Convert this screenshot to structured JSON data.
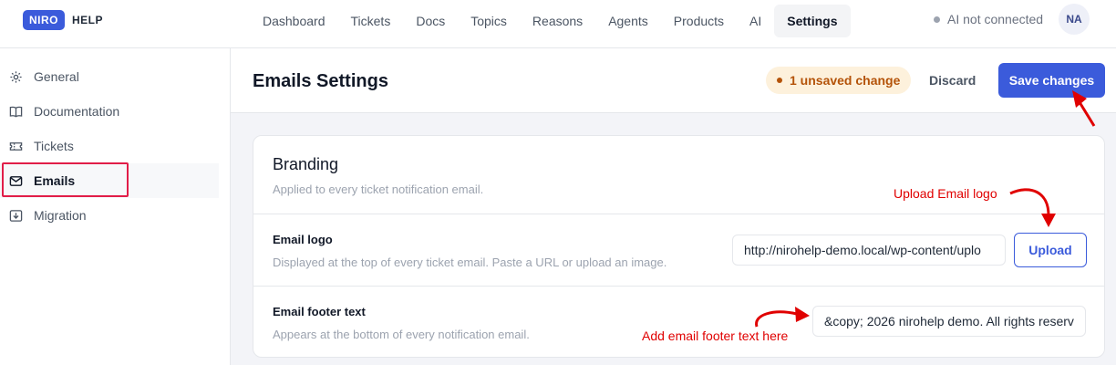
{
  "brand": {
    "badge": "NIRO",
    "name": "HELP"
  },
  "nav": {
    "items": [
      {
        "label": "Dashboard",
        "active": false
      },
      {
        "label": "Tickets",
        "active": false
      },
      {
        "label": "Docs",
        "active": false
      },
      {
        "label": "Topics",
        "active": false
      },
      {
        "label": "Reasons",
        "active": false
      },
      {
        "label": "Agents",
        "active": false
      },
      {
        "label": "Products",
        "active": false
      },
      {
        "label": "AI",
        "active": false
      },
      {
        "label": "Settings",
        "active": true
      }
    ]
  },
  "ai_status": "AI not connected",
  "avatar": "NA",
  "sidebar": {
    "items": [
      {
        "label": "General",
        "icon": "gear-icon"
      },
      {
        "label": "Documentation",
        "icon": "book-icon"
      },
      {
        "label": "Tickets",
        "icon": "ticket-icon"
      },
      {
        "label": "Emails",
        "icon": "mail-icon",
        "active": true
      },
      {
        "label": "Migration",
        "icon": "download-icon"
      }
    ]
  },
  "header": {
    "title": "Emails Settings",
    "unsaved": "1 unsaved change",
    "discard": "Discard",
    "save": "Save changes"
  },
  "branding": {
    "title": "Branding",
    "subtitle": "Applied to every ticket notification email.",
    "logo_label": "Email logo",
    "logo_help": "Displayed at the top of every ticket email. Paste a URL or upload an image.",
    "logo_value": "http://nirohelp-demo.local/wp-content/uplo",
    "upload": "Upload",
    "footer_label": "Email footer text",
    "footer_help": "Appears at the bottom of every notification email.",
    "footer_value": "&copy; 2026 nirohelp demo. All rights reserv"
  },
  "annotations": {
    "upload_logo": "Upload Email logo",
    "footer_text": "Add email footer text here"
  },
  "colors": {
    "accent": "#3b5bdb",
    "warning_bg": "#fdf1dc",
    "warning_text": "#b45309",
    "annotation": "#e00000"
  }
}
